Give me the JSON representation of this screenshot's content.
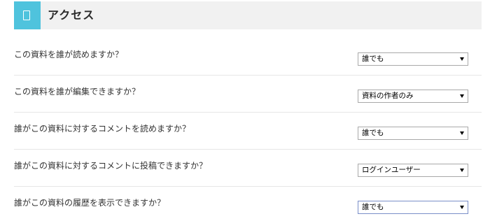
{
  "section": {
    "title": "アクセス",
    "icon": "document-icon",
    "accent_color": "#4fc3dd"
  },
  "rows": [
    {
      "question": "この資料を誰が読めますか？",
      "selected": "誰でも"
    },
    {
      "question": "この資料を誰が編集できますか？",
      "selected": "資料の作者のみ"
    },
    {
      "question": "誰がこの資料に対するコメントを読めますか？",
      "selected": "誰でも"
    },
    {
      "question": "誰がこの資料に対するコメントに投稿できますか？",
      "selected": "ログインユーザー"
    },
    {
      "question": "誰がこの資料の履歴を表示できますか？",
      "selected": "誰でも"
    }
  ]
}
